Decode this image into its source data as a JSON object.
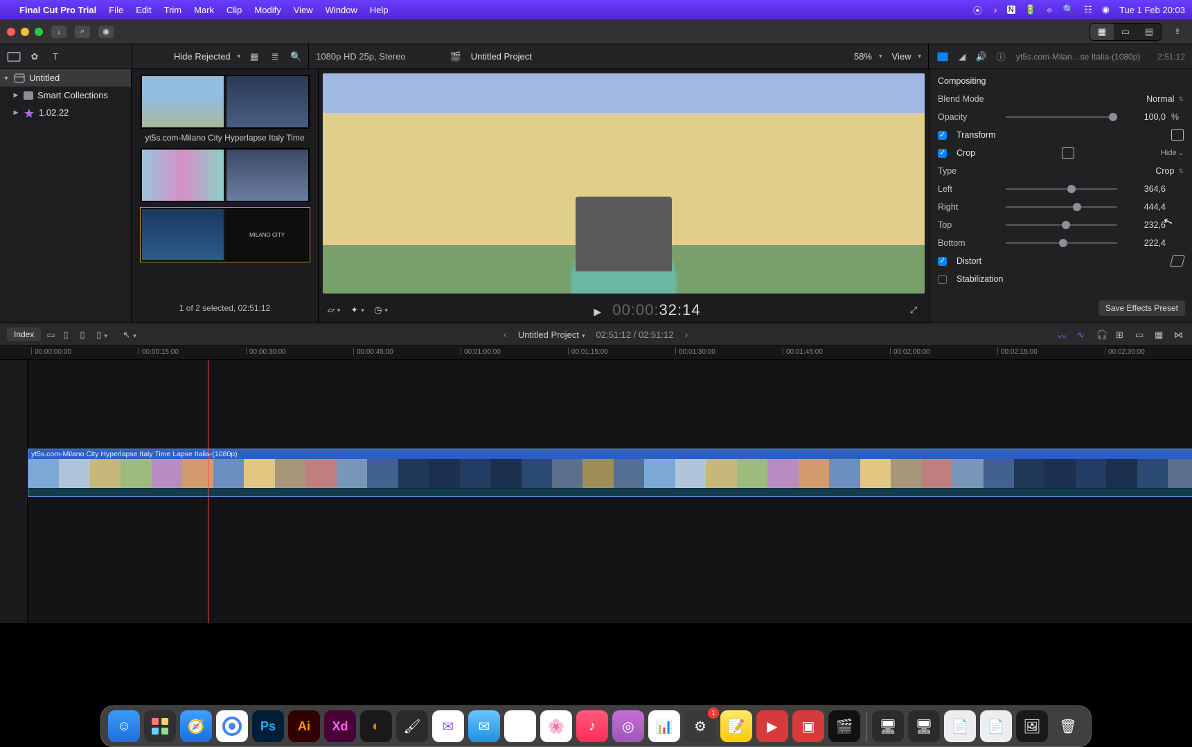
{
  "menubar": {
    "app": "Final Cut Pro Trial",
    "items": [
      "File",
      "Edit",
      "Trim",
      "Mark",
      "Clip",
      "Modify",
      "View",
      "Window",
      "Help"
    ],
    "clock": "Tue 1 Feb  20:03"
  },
  "toolbar2": {
    "filter_label": "Hide Rejected",
    "format": "1080p HD 25p, Stereo",
    "project": "Untitled Project",
    "zoom": "58%",
    "view": "View",
    "clip_name": "yt5s.com-Milan…se Italia-(1080p)",
    "clip_dur": "2:51:12"
  },
  "sidebar": {
    "library": "Untitled",
    "smart": "Smart Collections",
    "event": "1.02.22"
  },
  "browser": {
    "clip_caption": "yt5s.com-Milano City Hyperlapse Italy Time",
    "status": "1 of 2 selected, 02:51:12"
  },
  "viewer": {
    "timecode_dim": "00:00:",
    "timecode_bright": "32:14"
  },
  "inspector": {
    "compositing": "Compositing",
    "blend_label": "Blend Mode",
    "blend_value": "Normal",
    "opacity_label": "Opacity",
    "opacity_value": "100,0",
    "opacity_unit": "%",
    "transform": "Transform",
    "crop": "Crop",
    "hide": "Hide",
    "type_label": "Type",
    "type_value": "Crop",
    "left_label": "Left",
    "left_value": "364,6",
    "right_label": "Right",
    "right_value": "444,4",
    "top_label": "Top",
    "top_value": "232,6",
    "bottom_label": "Bottom",
    "bottom_value": "222,4",
    "distort": "Distort",
    "stab": "Stabilization",
    "preset": "Save Effects Preset"
  },
  "tlhead": {
    "index": "Index",
    "project": "Untitled Project",
    "position": "02:51:12 / 02:51:12"
  },
  "ruler": [
    "00:00:00:00",
    "00:00:15:00",
    "00:00:30:00",
    "00:00:45:00",
    "00:01:00:00",
    "00:01:15:00",
    "00:01:30:00",
    "00:01:45:00",
    "00:02:00:00",
    "00:02:15:00",
    "00:02:30:00"
  ],
  "clip_title": "yt5s.com-Milano City Hyperlapse Italy Time Lapse Italia-(1080p)",
  "palette": {
    "film": [
      "#7ba8d4",
      "#b0c5da",
      "#c8b77a",
      "#9dbb7d",
      "#b88bc1",
      "#d39a6e",
      "#6c8fc2",
      "#e2c780",
      "#a7967a",
      "#bf7f7e",
      "#7897b8",
      "#43618f",
      "#203858",
      "#1d2f4e",
      "#223d63",
      "#1b304c",
      "#2b4a73",
      "#5c6f8d",
      "#9e8e55",
      "#536f91"
    ]
  },
  "dock": {
    "settings_badge": "1"
  }
}
